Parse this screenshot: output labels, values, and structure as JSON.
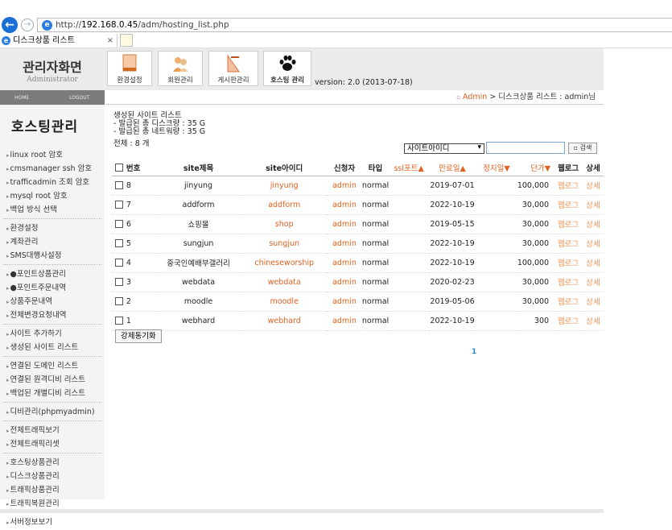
{
  "browser": {
    "url_prefix": "http://",
    "url_host": "192.168.0.45",
    "url_path": "/adm/hosting_list.php",
    "tab_title": "디스크상품 리스트"
  },
  "header": {
    "title": "관리자화면",
    "subtitle": "Administrator",
    "menu": [
      {
        "label": "환경설정",
        "icon": "notebook-icon"
      },
      {
        "label": "회원관리",
        "icon": "members-icon"
      },
      {
        "label": "게시판관리",
        "icon": "board-icon"
      },
      {
        "label": "호스팅 관리",
        "icon": "paw-icon"
      }
    ],
    "version": "version: 2.0 (2013-07-18)"
  },
  "sidebar": {
    "home": "HOME",
    "logout": "LOGOUT",
    "title": "호스팅관리",
    "groups": [
      [
        "linux root 암호",
        "cmsmanager ssh 암호",
        "trafficadmin 조회 암호",
        "mysql root 암호",
        "백업 방식 선택"
      ],
      [
        "환경설정",
        "계좌관리",
        "SMS대행사설정"
      ],
      [
        "●포인트상품관리",
        "●포인트주문내역",
        "상품주문내역",
        "전체변경요청내역"
      ],
      [
        "사이트 추가하기",
        "생성된 사이트 리스트"
      ],
      [
        "연결된 도메인 리스트",
        "연결된 원격디비 리스트",
        "백업된 개별디비 리스트"
      ],
      [
        "디비관리(phpmyadmin)"
      ],
      [
        "전체트래픽보기",
        "전체트래픽리셋"
      ],
      [
        "호스팅상품관리",
        "디스크상품관리",
        "트래픽상품관리",
        "트래픽복원관리"
      ],
      [
        "서버정보보기"
      ]
    ]
  },
  "breadcrumb": {
    "admin": "Admin",
    "rest": " > 디스크상품 리스트 : admin님"
  },
  "summary": {
    "line1": "생성된 사이트 리스트",
    "line2": "- 발급된 총 디스크량 : 35 G",
    "line3": "- 발급된 총 네트워량 : 35 G",
    "total": "전체 : 8 개"
  },
  "search": {
    "select_value": "사이트아이디",
    "button": "검색"
  },
  "table": {
    "headers": {
      "no": "번호",
      "title": "site제목",
      "id": "site아이디",
      "applicant": "신청자",
      "type": "타입",
      "ssl": "ssl포트▲",
      "expire": "만료일▲",
      "stopped": "정지일▼",
      "price": "단가▼",
      "weblog": "웹로그",
      "detail": "상세"
    },
    "rows": [
      {
        "no": "8",
        "title": "jinyung",
        "id": "jinyung",
        "applicant": "admin",
        "type": "normal",
        "expire": "2019-07-01",
        "price": "100,000",
        "weblog": "웹로그",
        "detail": "상세"
      },
      {
        "no": "7",
        "title": "addform",
        "id": "addform",
        "applicant": "admin",
        "type": "normal",
        "expire": "2022-10-19",
        "price": "30,000",
        "weblog": "웹로그",
        "detail": "상세"
      },
      {
        "no": "6",
        "title": "쇼핑몰",
        "id": "shop",
        "applicant": "admin",
        "type": "normal",
        "expire": "2019-05-15",
        "price": "30,000",
        "weblog": "웹로그",
        "detail": "상세"
      },
      {
        "no": "5",
        "title": "sungjun",
        "id": "sungjun",
        "applicant": "admin",
        "type": "normal",
        "expire": "2022-10-19",
        "price": "30,000",
        "weblog": "웹로그",
        "detail": "상세"
      },
      {
        "no": "4",
        "title": "중국인예배부갤러리",
        "id": "chineseworship",
        "applicant": "admin",
        "type": "normal",
        "expire": "2022-10-19",
        "price": "100,000",
        "weblog": "웹로그",
        "detail": "상세"
      },
      {
        "no": "3",
        "title": "webdata",
        "id": "webdata",
        "applicant": "admin",
        "type": "normal",
        "expire": "2020-02-23",
        "price": "30,000",
        "weblog": "웹로그",
        "detail": "상세"
      },
      {
        "no": "2",
        "title": "moodle",
        "id": "moodle",
        "applicant": "admin",
        "type": "normal",
        "expire": "2019-05-06",
        "price": "30,000",
        "weblog": "웹로그",
        "detail": "상세"
      },
      {
        "no": "1",
        "title": "webhard",
        "id": "webhard",
        "applicant": "admin",
        "type": "normal",
        "expire": "2022-10-19",
        "price": "300",
        "weblog": "웹로그",
        "detail": "상세"
      }
    ]
  },
  "sync_button": "강제동기화",
  "pager": "1"
}
